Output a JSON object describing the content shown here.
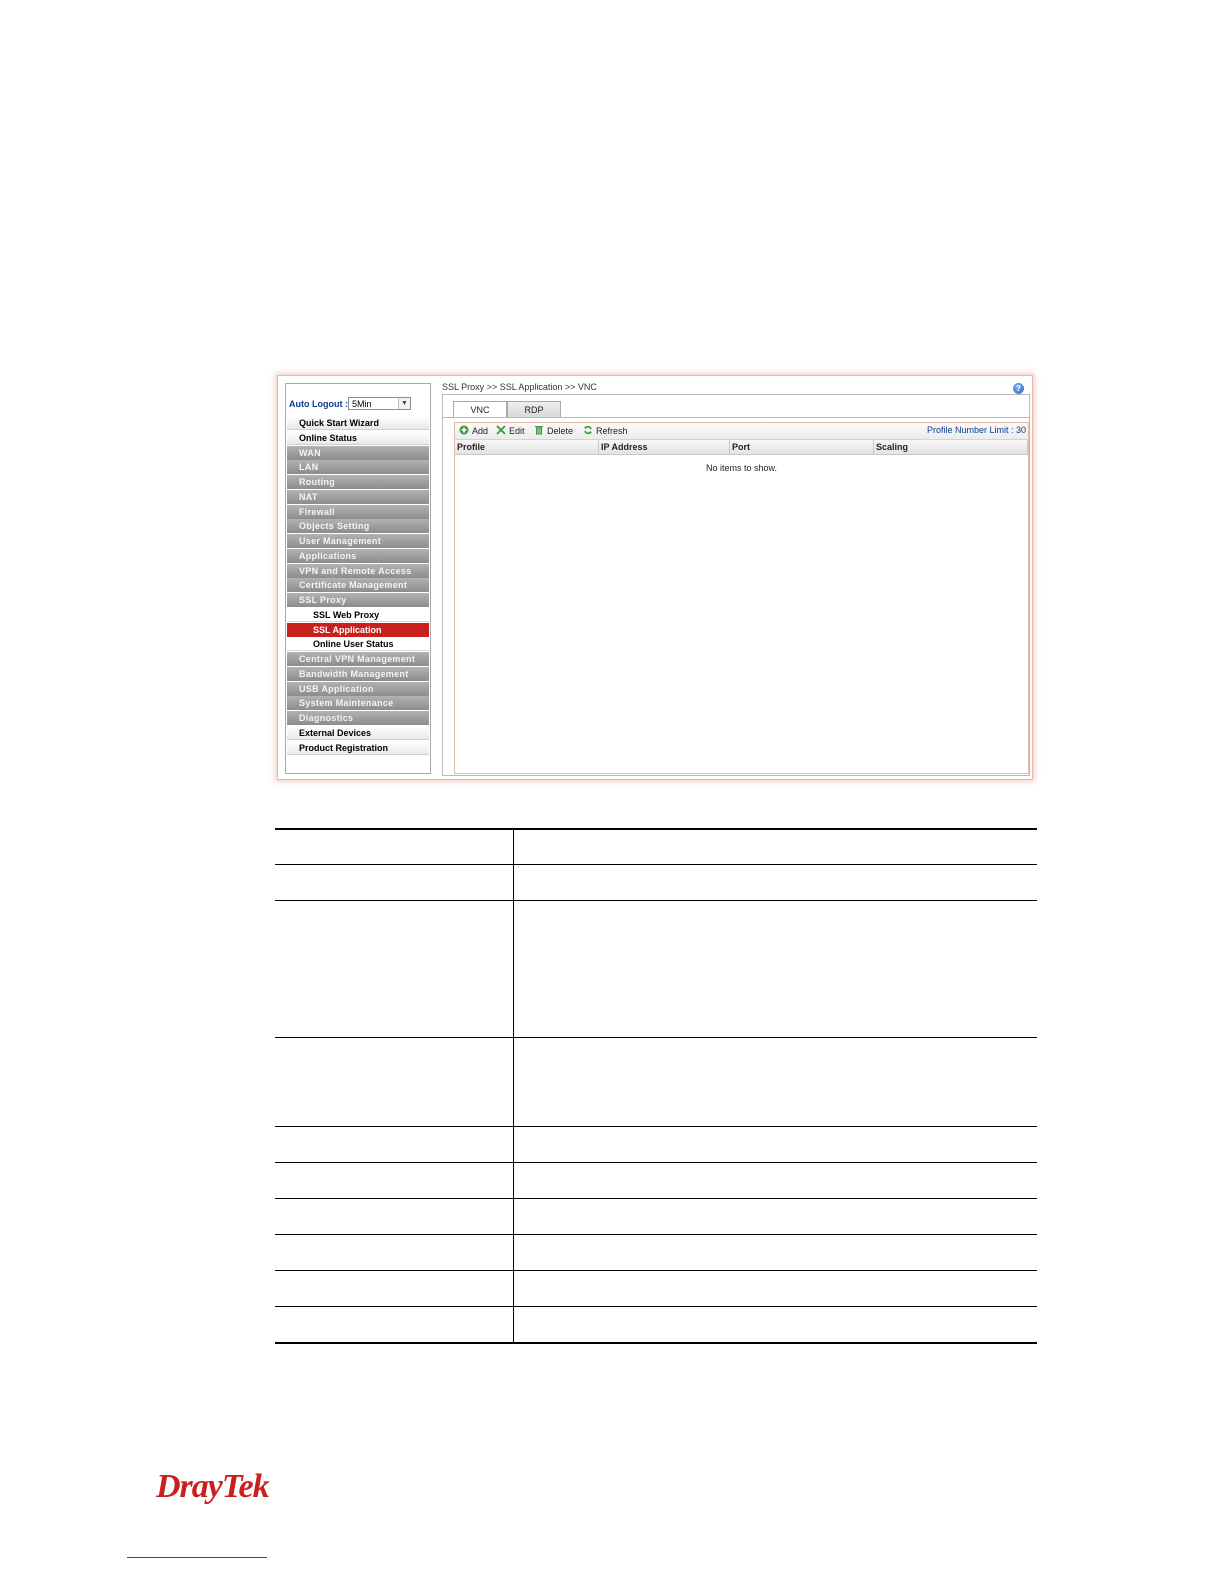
{
  "sidebar": {
    "auto_logout_label": "Auto Logout :",
    "auto_logout_value": "5Min",
    "items": [
      {
        "label": "Quick Start Wizard",
        "style": "w"
      },
      {
        "label": "Online Status",
        "style": "w"
      },
      {
        "label": "WAN",
        "style": "g"
      },
      {
        "label": "LAN",
        "style": "g"
      },
      {
        "label": "Routing",
        "style": "g"
      },
      {
        "label": "NAT",
        "style": "g"
      },
      {
        "label": "Firewall",
        "style": "g"
      },
      {
        "label": "Objects Setting",
        "style": "g"
      },
      {
        "label": "User Management",
        "style": "g"
      },
      {
        "label": "Applications",
        "style": "g"
      },
      {
        "label": "VPN and Remote Access",
        "style": "g"
      },
      {
        "label": "Certificate Management",
        "style": "g"
      },
      {
        "label": "SSL Proxy",
        "style": "g"
      },
      {
        "label": "SSL Web Proxy",
        "style": "s"
      },
      {
        "label": "SSL Application",
        "style": "a"
      },
      {
        "label": "Online User Status",
        "style": "s"
      },
      {
        "label": "Central VPN Management",
        "style": "g"
      },
      {
        "label": "Bandwidth Management",
        "style": "g"
      },
      {
        "label": "USB Application",
        "style": "g"
      },
      {
        "label": "System Maintenance",
        "style": "g"
      },
      {
        "label": "Diagnostics",
        "style": "g"
      },
      {
        "label": "External Devices",
        "style": "w"
      },
      {
        "label": "Product Registration",
        "style": "w"
      }
    ]
  },
  "main": {
    "breadcrumb": "SSL Proxy >> SSL Application >> VNC",
    "tabs": [
      "VNC",
      "RDP"
    ],
    "toolbar": {
      "add": "Add",
      "edit": "Edit",
      "delete": "Delete",
      "refresh": "Refresh"
    },
    "limit": "Profile Number Limit : 30",
    "columns": [
      "Profile",
      "IP Address",
      "Port",
      "Scaling"
    ],
    "empty": "No items to show."
  },
  "footer": {
    "logo_dray": "Dray",
    "logo_tek": "Tek"
  },
  "colors": {
    "accent": "#c8201d",
    "link": "#0d3b8f"
  }
}
